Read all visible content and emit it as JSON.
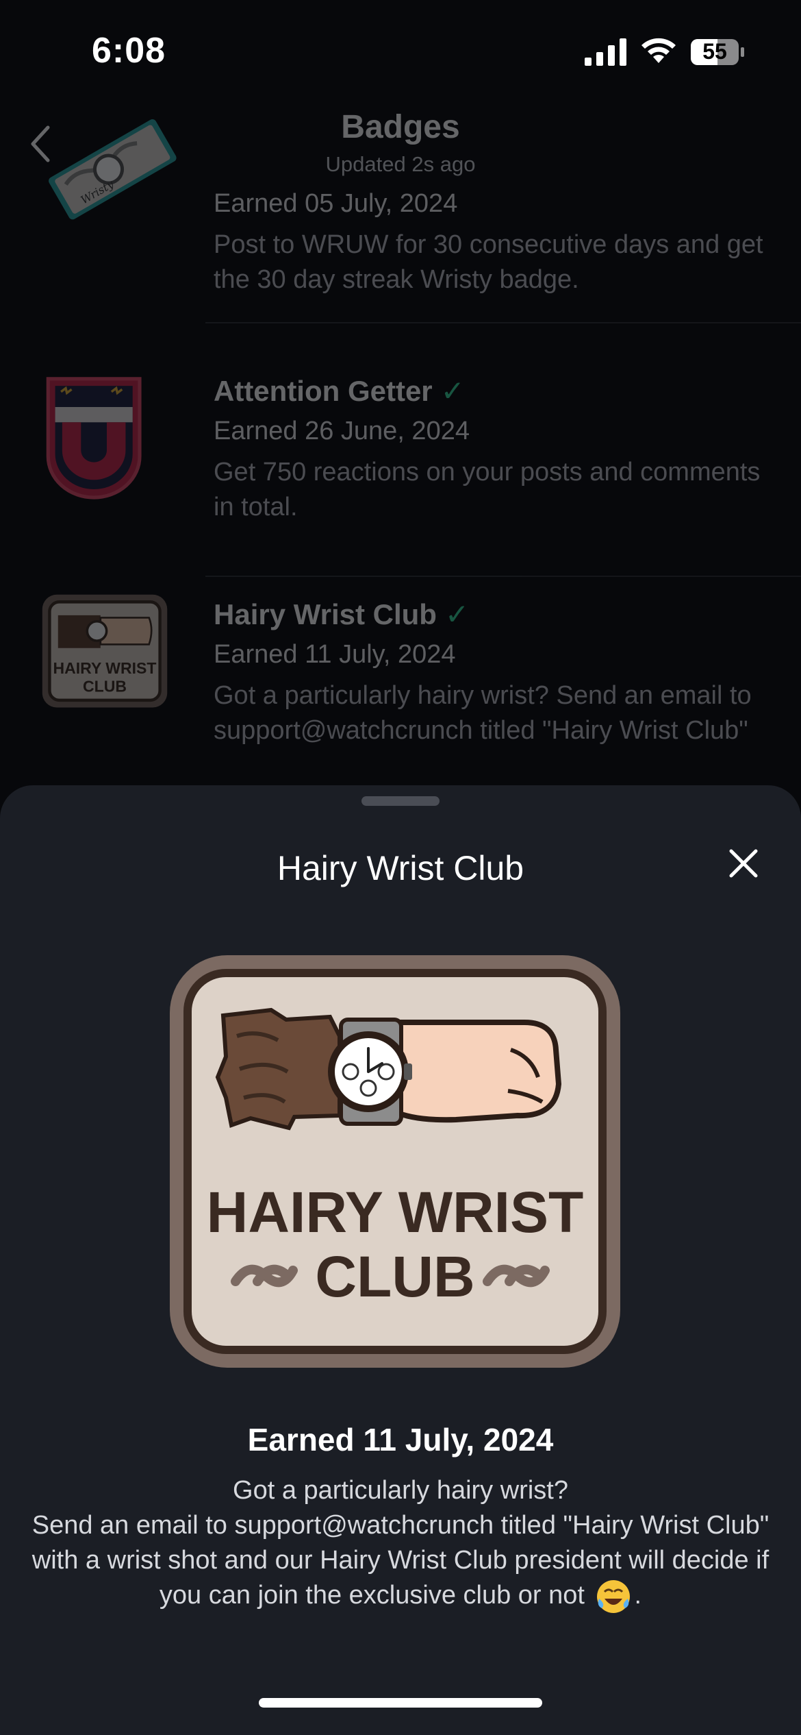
{
  "status_bar": {
    "time": "6:08",
    "battery": "55"
  },
  "nav": {
    "title": "Badges",
    "subtitle": "Updated 2s ago"
  },
  "badges": [
    {
      "name": "",
      "date": "Earned 05 July, 2024",
      "description": "Post to WRUW for 30 consecutive days and get the 30 day streak Wristy badge.",
      "badge_text": "Wristy"
    },
    {
      "name": "Attention Getter",
      "check": "✓",
      "date": "Earned 26 June, 2024",
      "description": "Get 750 reactions on your posts and comments in total."
    },
    {
      "name": "Hairy Wrist Club",
      "check": "✓",
      "date": "Earned 11 July, 2024",
      "description": "Got a particularly hairy wrist? Send an email to support@watchcrunch titled \"Hairy Wrist Club\" with a wrist shot and our Hairy Wrist Club president will decide if you can join the exclusive club or not 😂.",
      "badge_line1": "HAIRY WRIST",
      "badge_line2": "CLUB"
    }
  ],
  "sheet": {
    "title": "Hairy Wrist Club",
    "earned": "Earned 11 July, 2024",
    "line1": "Got a particularly hairy wrist?",
    "line2": "Send an email to support@watchcrunch titled \"Hairy Wrist Club\" with a wrist shot and our Hairy Wrist Club president will decide if you can join the exclusive club or not",
    "line2_end": ".",
    "badge_line1": "HAIRY WRIST",
    "badge_line2": "CLUB",
    "emoji": "tears-of-joy-emoji"
  },
  "colors": {
    "accent_check": "#35d39a",
    "sheet_bg": "#1b1e25",
    "page_bg": "#07080b"
  },
  "icons": [
    "signal-icon",
    "wifi-icon",
    "battery-icon",
    "back-chevron-icon",
    "close-icon"
  ]
}
